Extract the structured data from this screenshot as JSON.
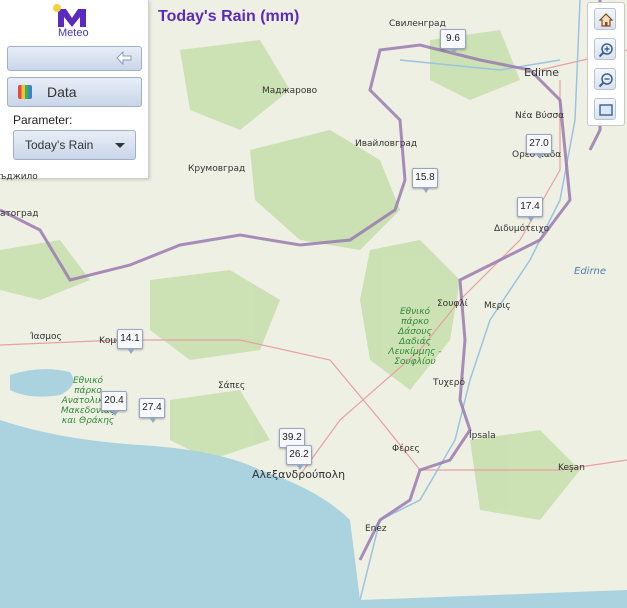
{
  "title": "Today's Rain (mm)",
  "logo": {
    "text": "Meteo",
    "icon": "meteo-m-logo"
  },
  "panel": {
    "back_icon": "arrow-left-icon",
    "data_button": {
      "label": "Data",
      "icon": "palette-icon"
    },
    "parameter_label": "Parameter:",
    "parameter_value": "Today's Rain"
  },
  "tools": [
    "home-icon",
    "zoom-in-icon",
    "zoom-out-icon",
    "full-extent-icon"
  ],
  "stations": [
    {
      "value": "9.6"
    },
    {
      "value": "27.0"
    },
    {
      "value": "15.8"
    },
    {
      "value": "17.4"
    },
    {
      "value": "14.1"
    },
    {
      "value": "20.4"
    },
    {
      "value": "27.4"
    },
    {
      "value": "39.2"
    },
    {
      "value": "26.2"
    }
  ],
  "places": [
    "Свиленград",
    "Edirne",
    "Маджарово",
    "Νέα Βύσσα",
    "Ивайловград",
    "Ορεστιάδα",
    "Крумовград",
    "Διδυμότειχο",
    "Edirne",
    "Σουφλί",
    "Μεριç",
    "Ίασμος",
    "Κομοτηνή",
    "Σάπες",
    "Τυχερό",
    "İpsala",
    "Φέρες",
    "Αλεξανδρούπολη",
    "Keşan",
    "Enez",
    "атоград",
    "ъджило"
  ],
  "parks": {
    "park1": "Εθνικό πάρκο Ανατολικής Μακεδονίας και Θράκης",
    "park2": "Εθνικό πάρκο Δάσους Δαδιάς Λευκίμμης - Σουφλίου"
  },
  "colors": {
    "title": "#5b2bbf",
    "sea": "#aad3df",
    "land": "#eef0e4",
    "forest": "#c8dfae",
    "border": "#9a7ab0"
  }
}
